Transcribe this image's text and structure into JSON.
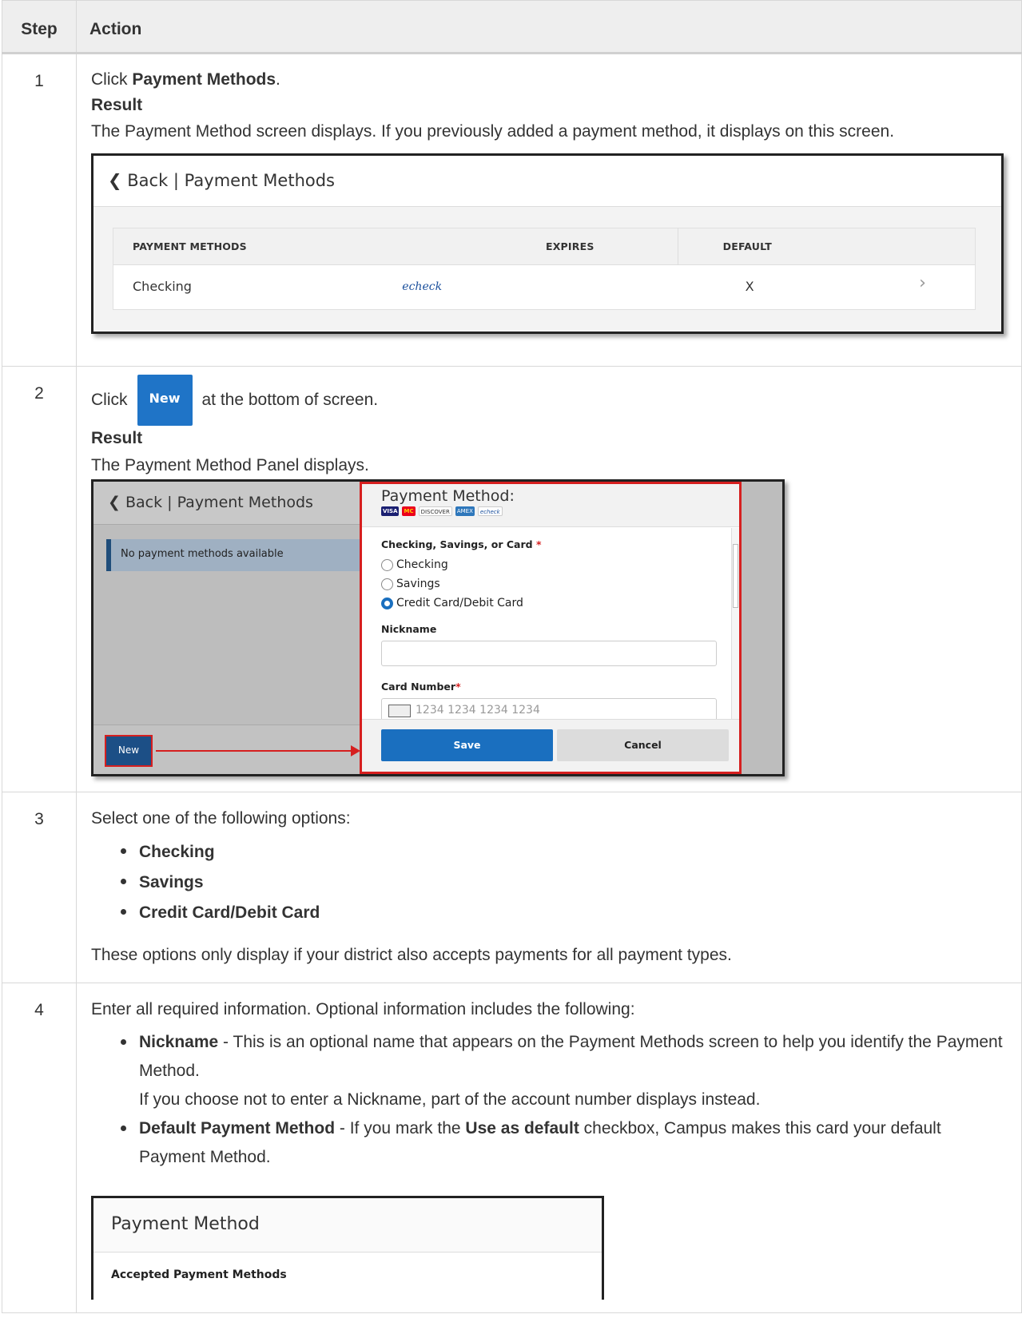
{
  "table": {
    "col_step": "Step",
    "col_action": "Action"
  },
  "steps": [
    {
      "num": "1",
      "click_prefix": "Click ",
      "click_target": "Payment Methods",
      "click_suffix": ".",
      "result_label": "Result",
      "result_text": "The Payment Method screen displays. If you previously added a payment method, it displays on this screen.",
      "screenshot": {
        "header": "❮ Back | Payment Methods",
        "col_methods": "PAYMENT METHODS",
        "col_expires": "EXPIRES",
        "col_default": "DEFAULT",
        "row_name": "Checking",
        "row_logo": "echeck",
        "row_default": "X",
        "row_chevron": "›"
      }
    },
    {
      "num": "2",
      "click_prefix": "Click",
      "button_label": "New",
      "click_suffix": "at the bottom of screen.",
      "result_label": "Result",
      "result_text": "The Payment Method Panel displays.",
      "screenshot": {
        "left_header": "❮ Back | Payment Methods",
        "empty_text": "No payment methods available",
        "new_label": "New",
        "panel_title": "Payment Method:",
        "cards": [
          "VISA",
          "MC",
          "DISCOVER",
          "AMEX",
          "echeck"
        ],
        "type_label": "Checking, Savings, or Card",
        "req_mark": "*",
        "options": [
          "Checking",
          "Savings",
          "Credit Card/Debit Card"
        ],
        "nickname_label": "Nickname",
        "card_label": "Card Number",
        "card_placeholder": "1234 1234 1234 1234",
        "save_label": "Save",
        "cancel_label": "Cancel"
      }
    },
    {
      "num": "3",
      "intro": "Select one of the following options:",
      "options": [
        "Checking",
        "Savings",
        "Credit Card/Debit Card"
      ],
      "note": "These options only display if your district also accepts payments for all payment types."
    },
    {
      "num": "4",
      "intro": "Enter all required information. Optional information includes the following:",
      "nickname_term": "Nickname",
      "nickname_desc": " - This is an optional name that appears on the Payment Methods screen to help you identify the Payment Method.",
      "nickname_extra": "If you choose not to enter a Nickname, part of the account number displays instead.",
      "default_term": "Default Payment Method",
      "default_desc_a": " - If you mark the ",
      "default_checkbox": "Use as default",
      "default_desc_b": " checkbox, Campus makes this card your default Payment Method.",
      "screenshot": {
        "header": "Payment Method",
        "sub": "Accepted Payment Methods"
      }
    }
  ],
  "colors": {
    "header_bg": "#eeeeee",
    "border": "#d8d8d8",
    "accent_blue": "#1a6fbf",
    "highlight_red": "#d61f1f"
  }
}
